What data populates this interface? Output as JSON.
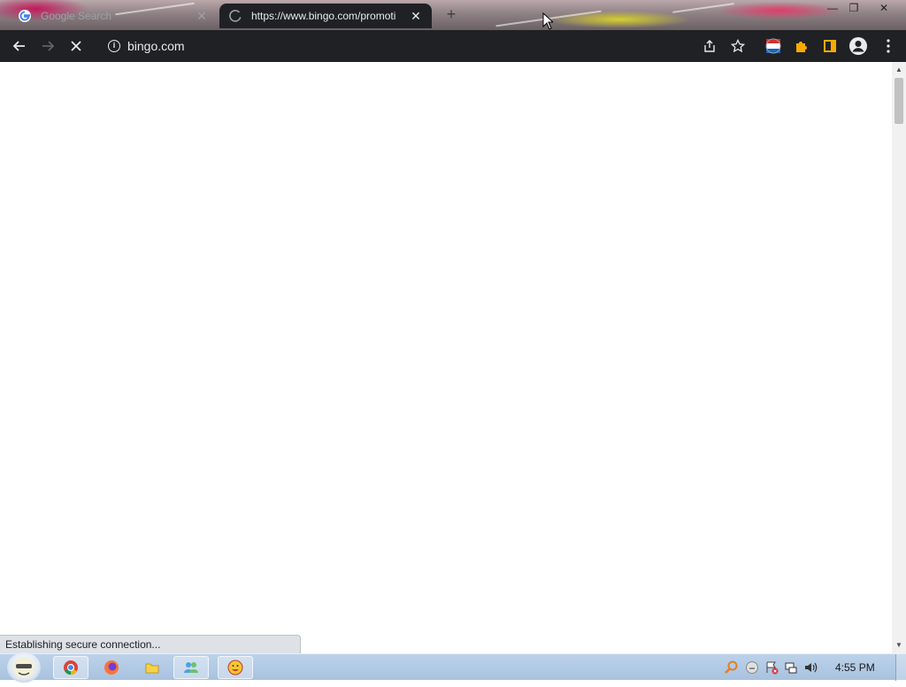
{
  "tabs": [
    {
      "title": "Google Search",
      "active": false,
      "favicon": "google-g-icon"
    },
    {
      "title": "https://www.bingo.com/promoti",
      "active": true,
      "favicon": "loading-spinner-icon"
    }
  ],
  "window_controls": {
    "minimize": "—",
    "restore": "❐",
    "close": "✕"
  },
  "omnibox": {
    "url": "bingo.com"
  },
  "status_bar": {
    "text": "Establishing secure connection..."
  },
  "taskbar": {
    "clock": "4:55 PM",
    "pinned": [
      "chrome",
      "firefox",
      "folder",
      "people",
      "emoji"
    ]
  },
  "colors": {
    "toolbar_bg": "#202124",
    "text_light": "#e8eaed",
    "extension_yellow": "#f9ab00",
    "taskbar_bg": "#bcd2ea"
  }
}
